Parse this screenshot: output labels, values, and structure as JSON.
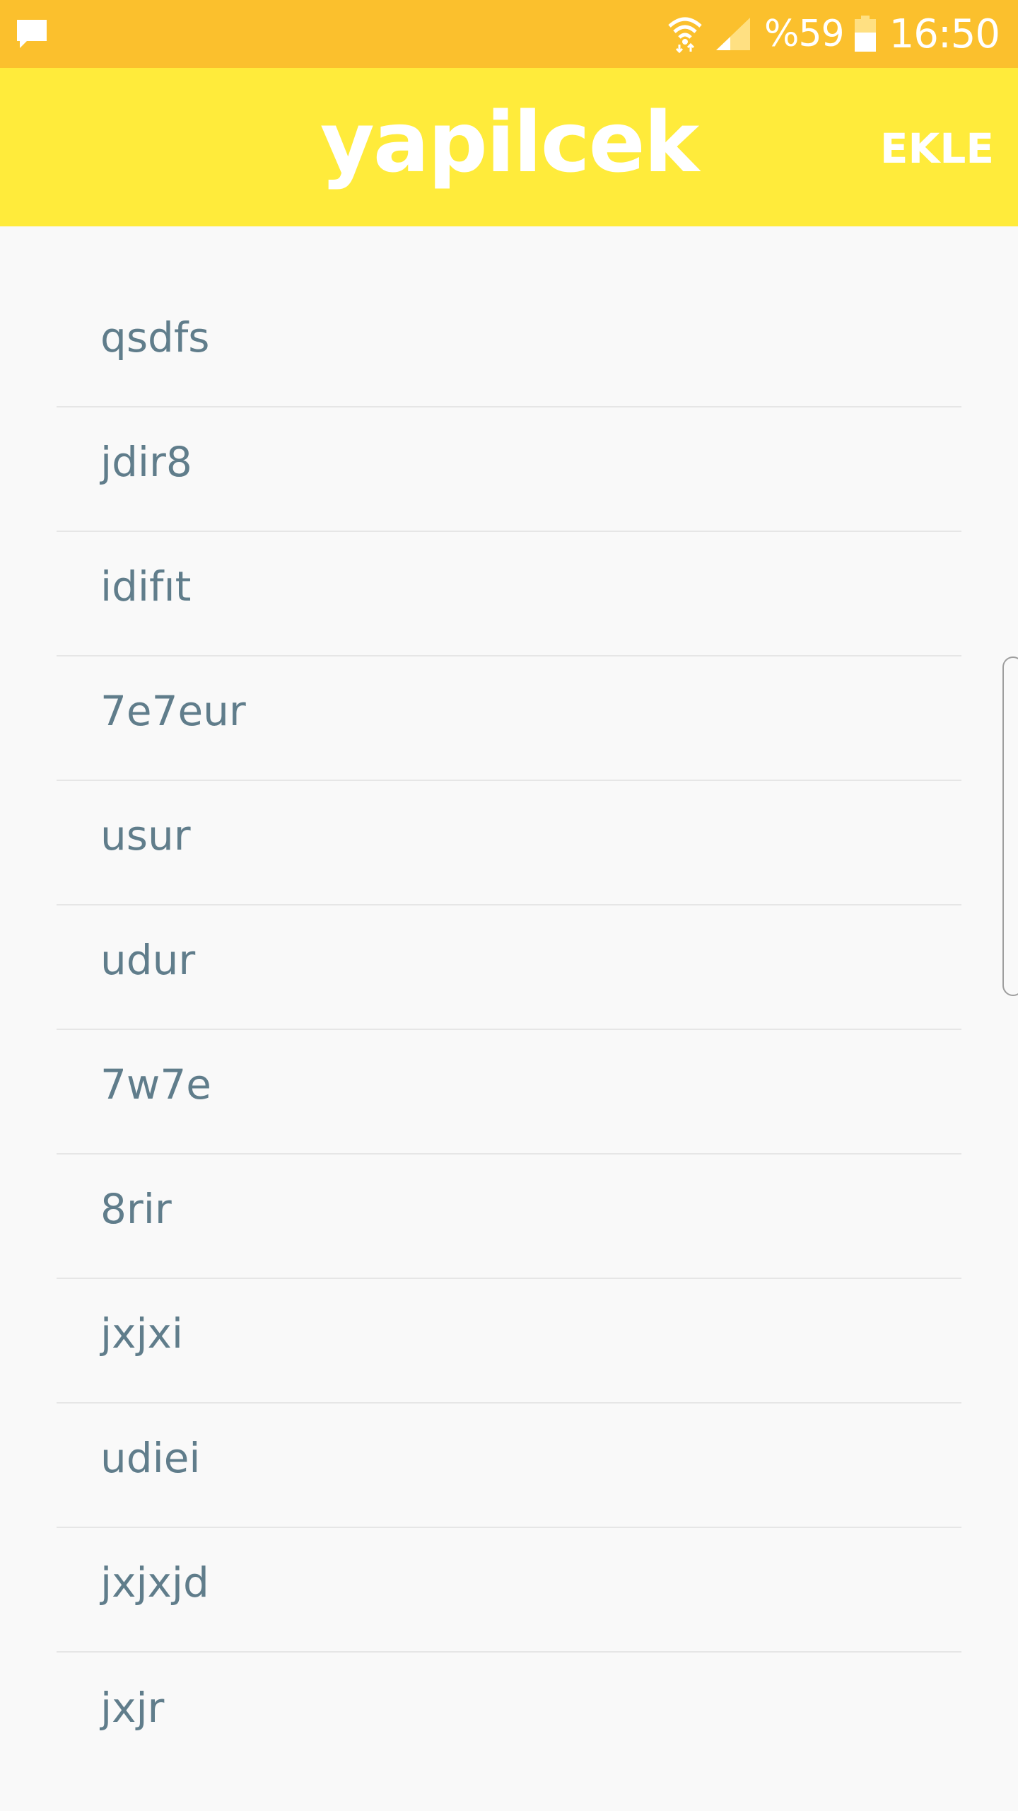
{
  "status_bar": {
    "left_icon": "message-icon",
    "wifi_icon": "wifi-icon",
    "signal_icon": "signal-icon",
    "battery_text": "%59",
    "battery_icon": "battery-icon",
    "time": "16:50",
    "color": "#fbc02d"
  },
  "app_bar": {
    "title": "yapilcek",
    "add_label": "EKLE",
    "color": "#ffeb3b"
  },
  "list": {
    "items": [
      {
        "label": "qsdfs"
      },
      {
        "label": "jdir8"
      },
      {
        "label": "idifıt"
      },
      {
        "label": "7e7eur"
      },
      {
        "label": "usur"
      },
      {
        "label": "udur"
      },
      {
        "label": "7w7e"
      },
      {
        "label": "8rir"
      },
      {
        "label": "jxjxi"
      },
      {
        "label": "udiei"
      },
      {
        "label": "jxjxjd"
      },
      {
        "label": "jxjr"
      }
    ],
    "text_color": "#607d8b"
  }
}
